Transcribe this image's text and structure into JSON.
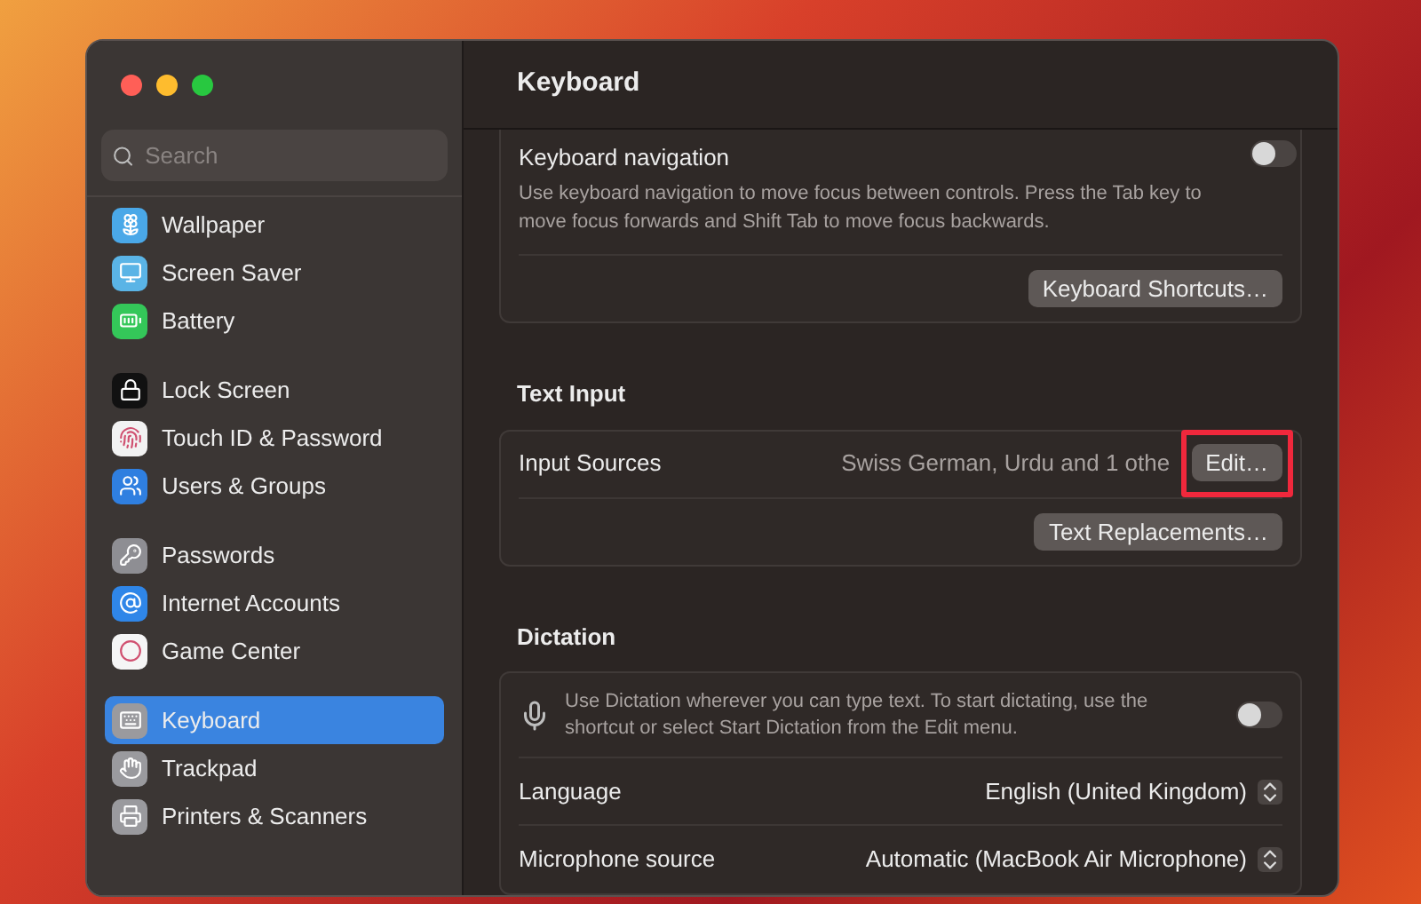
{
  "window": {
    "title": "Keyboard"
  },
  "sidebar": {
    "search": {
      "placeholder": "Search"
    },
    "groups": [
      [
        {
          "label": "Wallpaper",
          "selected": false,
          "color": "#4aa8e8"
        },
        {
          "label": "Screen Saver",
          "selected": false,
          "color": "#5ab4e6"
        },
        {
          "label": "Battery",
          "selected": false,
          "color": "#34c759"
        }
      ],
      [
        {
          "label": "Lock Screen",
          "selected": false,
          "color": "#111111"
        },
        {
          "label": "Touch ID & Password",
          "selected": false,
          "color": "#f2f2f2"
        },
        {
          "label": "Users & Groups",
          "selected": false,
          "color": "#2f7fe0"
        }
      ],
      [
        {
          "label": "Passwords",
          "selected": false,
          "color": "#8e8e93"
        },
        {
          "label": "Internet Accounts",
          "selected": false,
          "color": "#2f86e8"
        },
        {
          "label": "Game Center",
          "selected": false,
          "color": "#f5f5f5"
        }
      ],
      [
        {
          "label": "Keyboard",
          "selected": true,
          "color": "#9a9a9e"
        },
        {
          "label": "Trackpad",
          "selected": false,
          "color": "#9a9a9e"
        },
        {
          "label": "Printers & Scanners",
          "selected": false,
          "color": "#9a9a9e"
        }
      ]
    ]
  },
  "navigation": {
    "label": "Keyboard navigation",
    "description": "Use keyboard navigation to move focus between controls. Press the Tab key to move focus forwards and Shift Tab to move focus backwards.",
    "on": false,
    "button": "Keyboard Shortcuts…"
  },
  "text_input": {
    "heading": "Text Input",
    "input_sources": {
      "label": "Input Sources",
      "value": "Swiss German, Urdu and 1 othe",
      "button": "Edit…",
      "highlighted": true
    },
    "button": "Text Replacements…"
  },
  "dictation": {
    "heading": "Dictation",
    "description": "Use Dictation wherever you can type text. To start dictating, use the shortcut or select Start Dictation from the Edit menu.",
    "on": false,
    "rows": [
      {
        "label": "Language",
        "value": "English (United Kingdom)"
      },
      {
        "label": "Microphone source",
        "value": "Automatic (MacBook Air Microphone)"
      }
    ]
  }
}
